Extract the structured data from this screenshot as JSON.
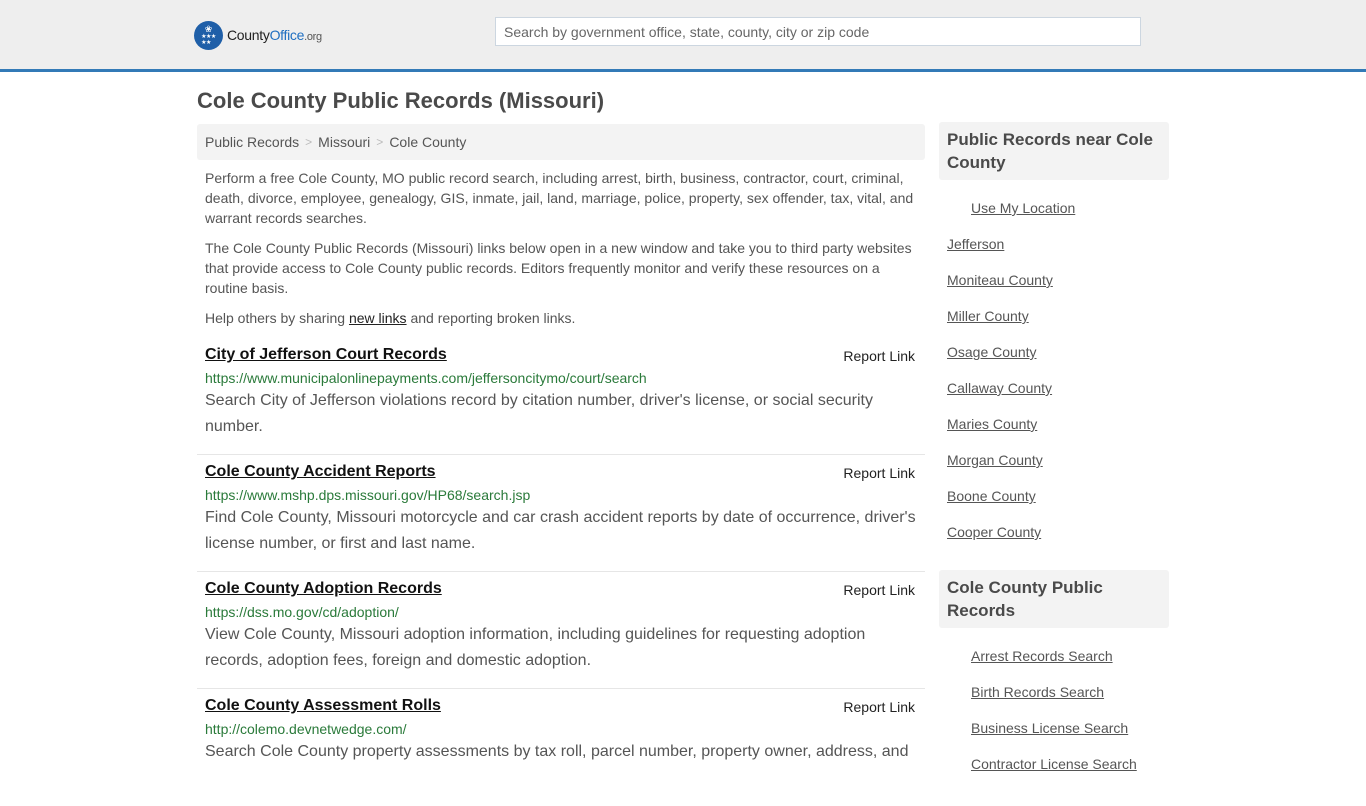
{
  "header": {
    "logo": {
      "brand_prefix": "County",
      "brand_main": "Office",
      "brand_suffix": ".org",
      "icon": "eagle-stars-icon"
    },
    "search": {
      "placeholder": "Search by government office, state, county, city or zip code",
      "value": ""
    }
  },
  "page_title": "Cole County Public Records (Missouri)",
  "breadcrumb": [
    {
      "label": "Public Records"
    },
    {
      "label": "Missouri"
    },
    {
      "label": "Cole County"
    }
  ],
  "breadcrumb_separator": ">",
  "intro": {
    "p1": "Perform a free Cole County, MO public record search, including arrest, birth, business, contractor, court, criminal, death, divorce, employee, genealogy, GIS, inmate, jail, land, marriage, police, property, sex offender, tax, vital, and warrant records searches.",
    "p2": "The Cole County Public Records (Missouri) links below open in a new window and take you to third party websites that provide access to Cole County public records. Editors frequently monitor and verify these resources on a routine basis.",
    "p3_before": "Help others by sharing ",
    "p3_link": "new links",
    "p3_after": " and reporting broken links."
  },
  "records": [
    {
      "title": "City of Jefferson Court Records",
      "report_label": "Report Link",
      "url": "https://www.municipalonlinepayments.com/jeffersoncitymo/court/search",
      "description": "Search City of Jefferson violations record by citation number, driver's license, or social security number."
    },
    {
      "title": "Cole County Accident Reports",
      "report_label": "Report Link",
      "url": "https://www.mshp.dps.missouri.gov/HP68/search.jsp",
      "description": "Find Cole County, Missouri motorcycle and car crash accident reports by date of occurrence, driver's license number, or first and last name."
    },
    {
      "title": "Cole County Adoption Records",
      "report_label": "Report Link",
      "url": "https://dss.mo.gov/cd/adoption/",
      "description": "View Cole County, Missouri adoption information, including guidelines for requesting adoption records, adoption fees, foreign and domestic adoption."
    },
    {
      "title": "Cole County Assessment Rolls",
      "report_label": "Report Link",
      "url": "http://colemo.devnetwedge.com/",
      "description": "Search Cole County property assessments by tax roll, parcel number, property owner, address, and"
    }
  ],
  "sidebar": {
    "nearby": {
      "heading": "Public Records near Cole County",
      "use_location": "Use My Location",
      "items": [
        "Jefferson",
        "Moniteau County",
        "Miller County",
        "Osage County",
        "Callaway County",
        "Maries County",
        "Morgan County",
        "Boone County",
        "Cooper County"
      ]
    },
    "county_records": {
      "heading": "Cole County Public Records",
      "items": [
        "Arrest Records Search",
        "Birth Records Search",
        "Business License Search",
        "Contractor License Search"
      ]
    }
  },
  "colors": {
    "accent": "#337ab7",
    "logo_blue": "#1f5fa8",
    "url_green": "#2a7a3a",
    "header_bg": "#eeeeee",
    "panel_bg": "#f3f3f3"
  }
}
